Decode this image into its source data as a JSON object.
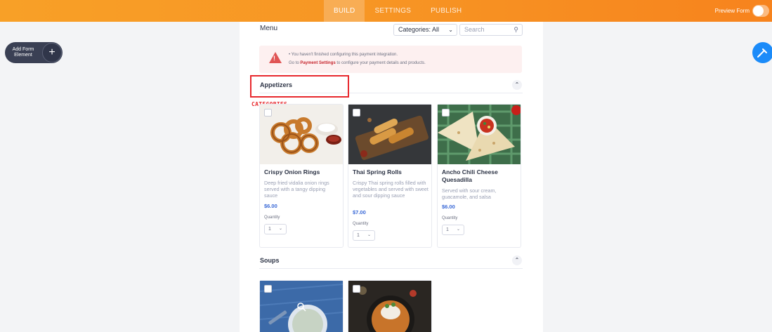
{
  "topbar": {
    "tabs": [
      "BUILD",
      "SETTINGS",
      "PUBLISH"
    ],
    "active_tab": "BUILD",
    "preview_label": "Preview Form"
  },
  "sidebar": {
    "add_label": "Add Form Element",
    "add_icon": "plus-icon"
  },
  "form": {
    "menu_title": "Menu",
    "category_select": "Categories: All",
    "search_placeholder": "Search",
    "alert": {
      "line1": "You haven't finished configuring this payment integration.",
      "line2_prefix": "Go to ",
      "line2_link": "Payment Settings",
      "line2_suffix": " to configure your payment details and products."
    },
    "annotation_label": "CATEGORIES",
    "sections": [
      {
        "title": "Appetizers",
        "products": [
          {
            "name": "Crispy Onion Rings",
            "description": "Deep fried vidalia onion rings served with a tangy dipping sauce",
            "price": "$6.00",
            "quantity_label": "Quantity",
            "quantity": "1"
          },
          {
            "name": "Thai Spring Rolls",
            "description": "Crispy Thai spring rolls filled with vegetables and served with sweet and sour dipping sauce",
            "price": "$7.00",
            "quantity_label": "Quantity",
            "quantity": "1"
          },
          {
            "name": "Ancho Chili Cheese Quesadilla",
            "description": "Served with sour cream, guacamole, and salsa",
            "price": "$6.00",
            "quantity_label": "Quantity",
            "quantity": "1"
          }
        ]
      },
      {
        "title": "Soups",
        "products": []
      }
    ]
  },
  "colors": {
    "topbar": "#f79524",
    "accent": "#3767d6",
    "highlight": "#e8282d",
    "paint_button": "#1b8bf9"
  }
}
